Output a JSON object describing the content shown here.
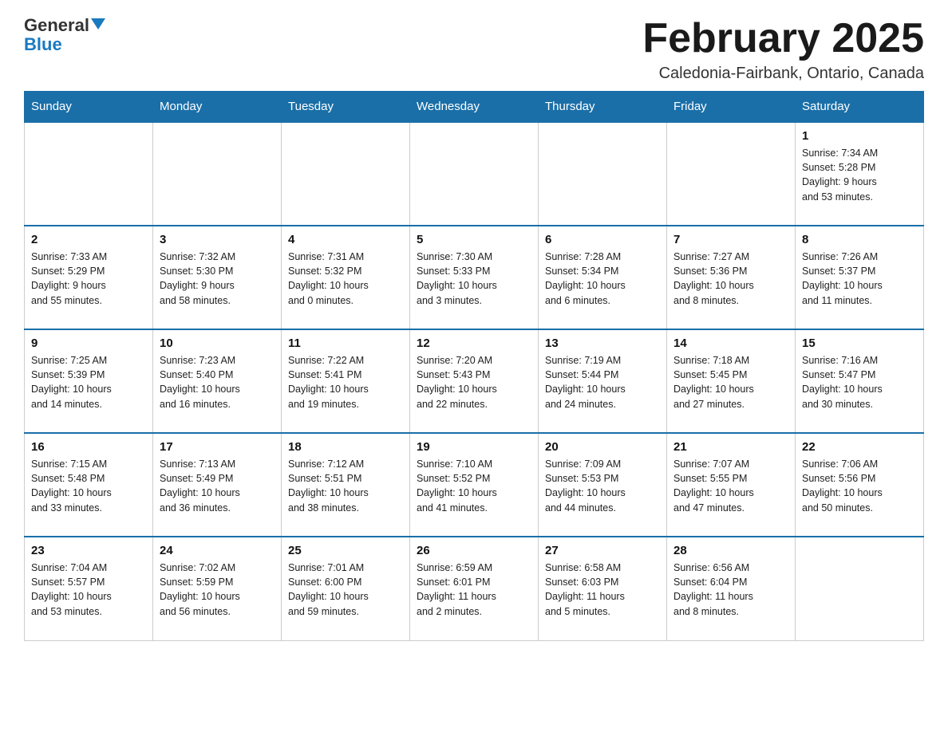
{
  "header": {
    "logo_general": "General",
    "logo_blue": "Blue",
    "month_title": "February 2025",
    "location": "Caledonia-Fairbank, Ontario, Canada"
  },
  "days_of_week": [
    "Sunday",
    "Monday",
    "Tuesday",
    "Wednesday",
    "Thursday",
    "Friday",
    "Saturday"
  ],
  "weeks": [
    [
      {
        "day": "",
        "info": ""
      },
      {
        "day": "",
        "info": ""
      },
      {
        "day": "",
        "info": ""
      },
      {
        "day": "",
        "info": ""
      },
      {
        "day": "",
        "info": ""
      },
      {
        "day": "",
        "info": ""
      },
      {
        "day": "1",
        "info": "Sunrise: 7:34 AM\nSunset: 5:28 PM\nDaylight: 9 hours\nand 53 minutes."
      }
    ],
    [
      {
        "day": "2",
        "info": "Sunrise: 7:33 AM\nSunset: 5:29 PM\nDaylight: 9 hours\nand 55 minutes."
      },
      {
        "day": "3",
        "info": "Sunrise: 7:32 AM\nSunset: 5:30 PM\nDaylight: 9 hours\nand 58 minutes."
      },
      {
        "day": "4",
        "info": "Sunrise: 7:31 AM\nSunset: 5:32 PM\nDaylight: 10 hours\nand 0 minutes."
      },
      {
        "day": "5",
        "info": "Sunrise: 7:30 AM\nSunset: 5:33 PM\nDaylight: 10 hours\nand 3 minutes."
      },
      {
        "day": "6",
        "info": "Sunrise: 7:28 AM\nSunset: 5:34 PM\nDaylight: 10 hours\nand 6 minutes."
      },
      {
        "day": "7",
        "info": "Sunrise: 7:27 AM\nSunset: 5:36 PM\nDaylight: 10 hours\nand 8 minutes."
      },
      {
        "day": "8",
        "info": "Sunrise: 7:26 AM\nSunset: 5:37 PM\nDaylight: 10 hours\nand 11 minutes."
      }
    ],
    [
      {
        "day": "9",
        "info": "Sunrise: 7:25 AM\nSunset: 5:39 PM\nDaylight: 10 hours\nand 14 minutes."
      },
      {
        "day": "10",
        "info": "Sunrise: 7:23 AM\nSunset: 5:40 PM\nDaylight: 10 hours\nand 16 minutes."
      },
      {
        "day": "11",
        "info": "Sunrise: 7:22 AM\nSunset: 5:41 PM\nDaylight: 10 hours\nand 19 minutes."
      },
      {
        "day": "12",
        "info": "Sunrise: 7:20 AM\nSunset: 5:43 PM\nDaylight: 10 hours\nand 22 minutes."
      },
      {
        "day": "13",
        "info": "Sunrise: 7:19 AM\nSunset: 5:44 PM\nDaylight: 10 hours\nand 24 minutes."
      },
      {
        "day": "14",
        "info": "Sunrise: 7:18 AM\nSunset: 5:45 PM\nDaylight: 10 hours\nand 27 minutes."
      },
      {
        "day": "15",
        "info": "Sunrise: 7:16 AM\nSunset: 5:47 PM\nDaylight: 10 hours\nand 30 minutes."
      }
    ],
    [
      {
        "day": "16",
        "info": "Sunrise: 7:15 AM\nSunset: 5:48 PM\nDaylight: 10 hours\nand 33 minutes."
      },
      {
        "day": "17",
        "info": "Sunrise: 7:13 AM\nSunset: 5:49 PM\nDaylight: 10 hours\nand 36 minutes."
      },
      {
        "day": "18",
        "info": "Sunrise: 7:12 AM\nSunset: 5:51 PM\nDaylight: 10 hours\nand 38 minutes."
      },
      {
        "day": "19",
        "info": "Sunrise: 7:10 AM\nSunset: 5:52 PM\nDaylight: 10 hours\nand 41 minutes."
      },
      {
        "day": "20",
        "info": "Sunrise: 7:09 AM\nSunset: 5:53 PM\nDaylight: 10 hours\nand 44 minutes."
      },
      {
        "day": "21",
        "info": "Sunrise: 7:07 AM\nSunset: 5:55 PM\nDaylight: 10 hours\nand 47 minutes."
      },
      {
        "day": "22",
        "info": "Sunrise: 7:06 AM\nSunset: 5:56 PM\nDaylight: 10 hours\nand 50 minutes."
      }
    ],
    [
      {
        "day": "23",
        "info": "Sunrise: 7:04 AM\nSunset: 5:57 PM\nDaylight: 10 hours\nand 53 minutes."
      },
      {
        "day": "24",
        "info": "Sunrise: 7:02 AM\nSunset: 5:59 PM\nDaylight: 10 hours\nand 56 minutes."
      },
      {
        "day": "25",
        "info": "Sunrise: 7:01 AM\nSunset: 6:00 PM\nDaylight: 10 hours\nand 59 minutes."
      },
      {
        "day": "26",
        "info": "Sunrise: 6:59 AM\nSunset: 6:01 PM\nDaylight: 11 hours\nand 2 minutes."
      },
      {
        "day": "27",
        "info": "Sunrise: 6:58 AM\nSunset: 6:03 PM\nDaylight: 11 hours\nand 5 minutes."
      },
      {
        "day": "28",
        "info": "Sunrise: 6:56 AM\nSunset: 6:04 PM\nDaylight: 11 hours\nand 8 minutes."
      },
      {
        "day": "",
        "info": ""
      }
    ]
  ]
}
